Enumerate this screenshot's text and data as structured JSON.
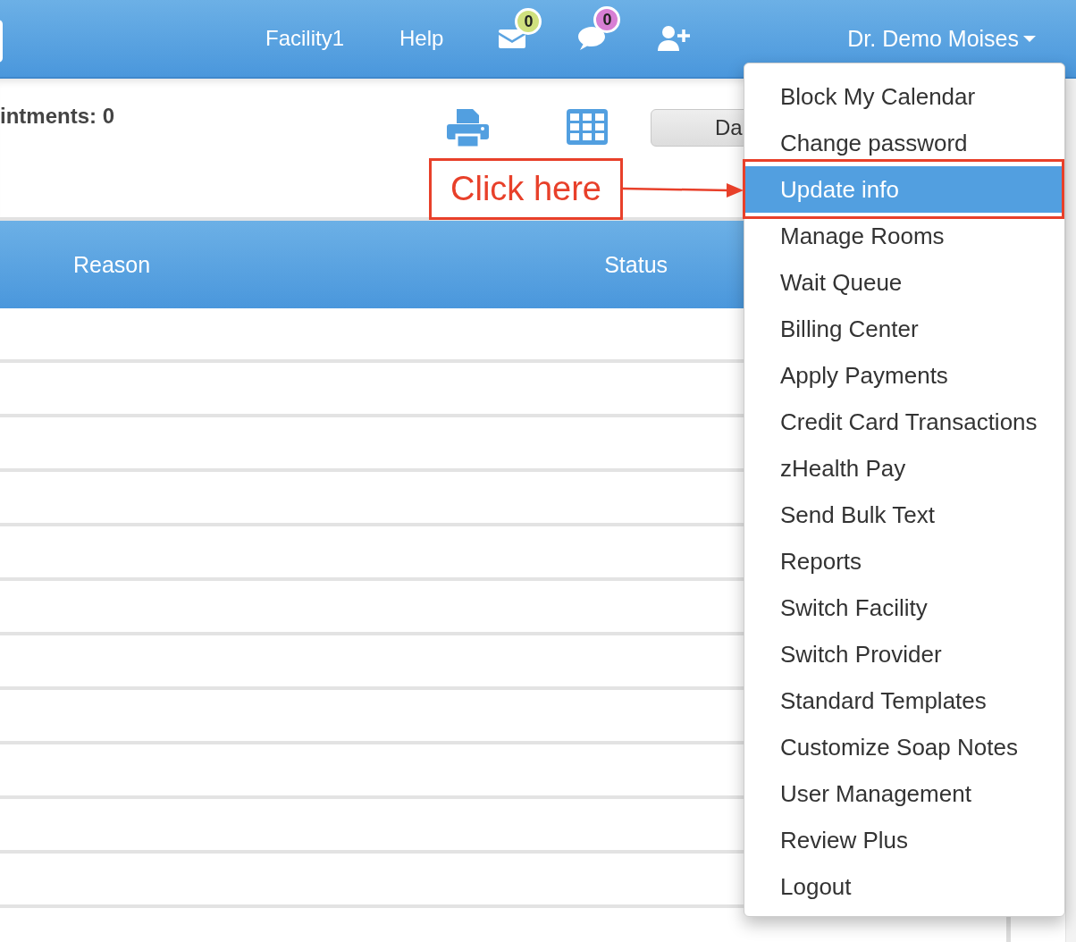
{
  "navbar": {
    "links": [
      {
        "label": "Facility1"
      },
      {
        "label": "Help"
      }
    ],
    "notifications": [
      {
        "kind": "mail",
        "count": "0",
        "color": "#cfe07e"
      },
      {
        "kind": "chat",
        "count": "0",
        "color": "#d77fd4"
      }
    ],
    "user_menu": {
      "label": "Dr. Demo Moises",
      "expanded": true
    }
  },
  "toolbar": {
    "summary": "intments: 0",
    "view_button": "Da"
  },
  "table": {
    "columns": [
      "Reason",
      "Status"
    ]
  },
  "dropdown": {
    "items": [
      {
        "label": "Block My Calendar",
        "selected": false
      },
      {
        "label": "Change password",
        "selected": false
      },
      {
        "label": "Update info",
        "selected": true
      },
      {
        "label": "Manage Rooms",
        "selected": false
      },
      {
        "label": "Wait Queue",
        "selected": false
      },
      {
        "label": "Billing Center",
        "selected": false
      },
      {
        "label": "Apply Payments",
        "selected": false
      },
      {
        "label": "Credit Card Transactions",
        "selected": false
      },
      {
        "label": "zHealth Pay",
        "selected": false
      },
      {
        "label": "Send Bulk Text",
        "selected": false
      },
      {
        "label": "Reports",
        "selected": false
      },
      {
        "label": "Switch Facility",
        "selected": false
      },
      {
        "label": "Switch Provider",
        "selected": false
      },
      {
        "label": "Standard Templates",
        "selected": false
      },
      {
        "label": "Customize Soap Notes",
        "selected": false
      },
      {
        "label": "User Management",
        "selected": false
      },
      {
        "label": "Review Plus",
        "selected": false
      },
      {
        "label": "Logout",
        "selected": false
      }
    ]
  },
  "annotation": {
    "callout": "Click here"
  }
}
